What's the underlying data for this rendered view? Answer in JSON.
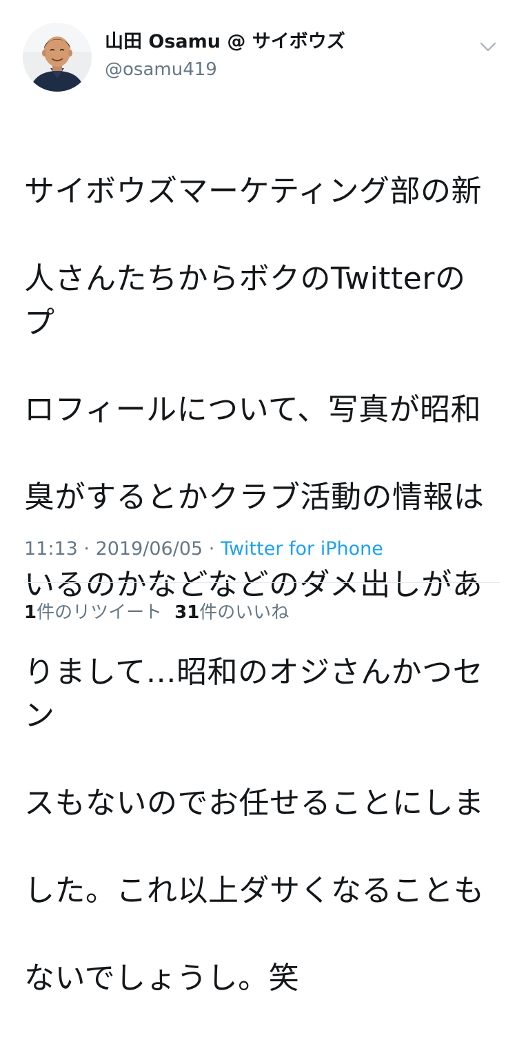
{
  "author": {
    "display_name": "山田 Osamu @ サイボウズ",
    "handle": "@osamu419"
  },
  "tweet": {
    "text_lines": [
      "サイボウズマーケティング部の新",
      "人さんたちからボクのTwitterのプ",
      "ロフィールについて、写真が昭和",
      "臭がするとかクラブ活動の情報は",
      "いるのかなどなどのダメ出しがあ",
      "りまして…昭和のオジさんかつセン",
      "スもないのでお任せることにしま",
      "した。これ以上ダサくなることも",
      "ないでしょうし。笑"
    ],
    "time": "11:13",
    "separator": " · ",
    "date": "2019/06/05",
    "source": "Twitter for iPhone"
  },
  "stats": {
    "retweet_count": "1",
    "retweet_label": "件のリツイート",
    "like_count": "31",
    "like_label": "件のいいね"
  },
  "icons": {
    "avatar": "profile-photo",
    "caret": "chevron-down-icon"
  },
  "colors": {
    "text": "#14171a",
    "secondary": "#657786",
    "link": "#1da1f2",
    "divider": "#e1e8ed"
  }
}
